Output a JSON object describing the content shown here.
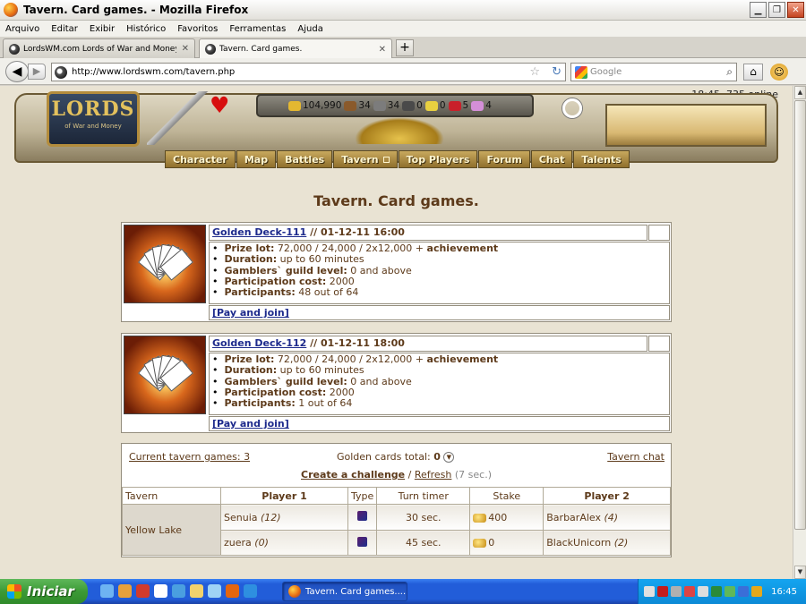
{
  "window": {
    "title": "Tavern. Card games. - Mozilla Firefox"
  },
  "menu": [
    "Arquivo",
    "Editar",
    "Exibir",
    "Histórico",
    "Favoritos",
    "Ferramentas",
    "Ajuda"
  ],
  "tabs": [
    {
      "label": "LordsWM.com Lords of War and Money. ...",
      "active": false
    },
    {
      "label": "Tavern. Card games.",
      "active": true
    }
  ],
  "nav": {
    "url": "http://www.lordswm.com/tavern.php",
    "search_placeholder": "Google"
  },
  "game": {
    "online": "18:45, 735 online",
    "logo_title": "LORDS",
    "logo_subtitle": "of War and Money",
    "resources": [
      "104,990",
      "34",
      "34",
      "0",
      "0",
      "5",
      "4"
    ],
    "menu": [
      "Character",
      "Map",
      "Battles",
      "Tavern",
      "Top Players",
      "Forum",
      "Chat",
      "Talents"
    ]
  },
  "page_title": "Tavern. Card games.",
  "tournaments": [
    {
      "name": "Golden Deck-111",
      "date": " // 01-12-11 16:00",
      "prize_label": "Prize lot:",
      "prize": " 72,000 / 24,000 / 2x12,000 + ",
      "prize_extra": "achievement",
      "duration_label": "Duration:",
      "duration": " up to 60 minutes",
      "guild_label": "Gamblers` guild level:",
      "guild": " 0 and above",
      "cost_label": "Participation cost:",
      "cost": " 2000",
      "participants_label": "Participants:",
      "participants": " 48 out of 64",
      "join": "[Pay and join]"
    },
    {
      "name": "Golden Deck-112",
      "date": " // 01-12-11 18:00",
      "prize_label": "Prize lot:",
      "prize": " 72,000 / 24,000 / 2x12,000 + ",
      "prize_extra": "achievement",
      "duration_label": "Duration:",
      "duration": " up to 60 minutes",
      "guild_label": "Gamblers` guild level:",
      "guild": " 0 and above",
      "cost_label": "Participation cost:",
      "cost": " 2000",
      "participants_label": "Participants:",
      "participants": " 1 out of 64",
      "join": "[Pay and join]"
    }
  ],
  "games": {
    "current": "Current tavern games: 3",
    "golden_label": "Golden cards total: ",
    "golden_value": "0",
    "chat": "Tavern chat",
    "create": "Create a challenge",
    "sep": " / ",
    "refresh": "Refresh",
    "refresh_time": " (7 sec.)",
    "headers": [
      "Tavern",
      "Player 1",
      "Type",
      "Turn timer",
      "Stake",
      "Player 2"
    ],
    "tavern_name": "Yellow Lake",
    "rows": [
      {
        "player1": "Senuia",
        "p1level": "(12)",
        "timer": "30 sec.",
        "stake": "400",
        "player2": "BarbarAlex",
        "p2level": "(4)"
      },
      {
        "player1": "zuera",
        "p1level": "(0)",
        "timer": "45 sec.",
        "stake": "0",
        "player2": "BlackUnicorn",
        "p2level": "(2)"
      }
    ]
  },
  "taskbar": {
    "start": "Iniciar",
    "task": "Tavern. Card games....",
    "clock": "16:45"
  }
}
